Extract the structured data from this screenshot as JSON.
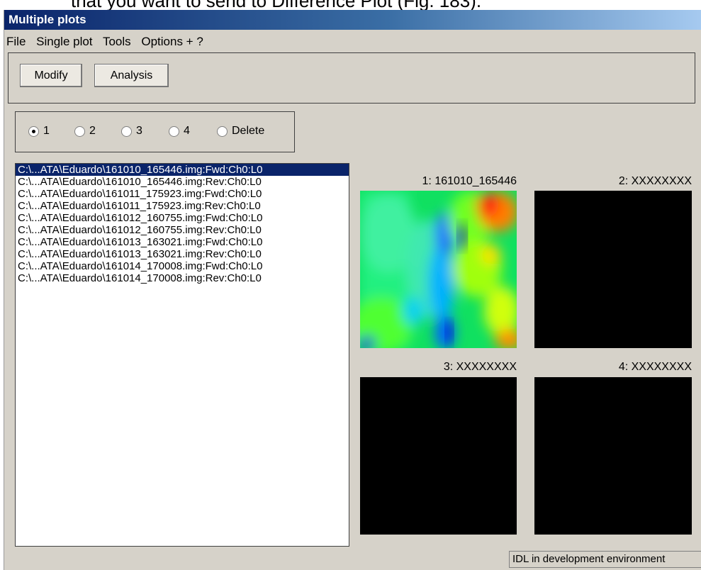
{
  "background_caption": "that you want to send to Difference Plot (Fig. 183).",
  "window": {
    "title": "Multiple plots"
  },
  "menu": [
    "File",
    "Single plot",
    "Tools",
    "Options + ?"
  ],
  "toolbar": {
    "modify_label": "Modify",
    "analysis_label": "Analysis"
  },
  "radio_group": {
    "selected": "1",
    "options": [
      "1",
      "2",
      "3",
      "4",
      "Delete"
    ]
  },
  "file_list": {
    "selected_index": 0,
    "items": [
      "C:\\...ATA\\Eduardo\\161010_165446.img:Fwd:Ch0:L0",
      "C:\\...ATA\\Eduardo\\161010_165446.img:Rev:Ch0:L0",
      "C:\\...ATA\\Eduardo\\161011_175923.img:Fwd:Ch0:L0",
      "C:\\...ATA\\Eduardo\\161011_175923.img:Rev:Ch0:L0",
      "C:\\...ATA\\Eduardo\\161012_160755.img:Fwd:Ch0:L0",
      "C:\\...ATA\\Eduardo\\161012_160755.img:Rev:Ch0:L0",
      "C:\\...ATA\\Eduardo\\161013_163021.img:Fwd:Ch0:L0",
      "C:\\...ATA\\Eduardo\\161013_163021.img:Rev:Ch0:L0",
      "C:\\...ATA\\Eduardo\\161014_170008.img:Fwd:Ch0:L0",
      "C:\\...ATA\\Eduardo\\161014_170008.img:Rev:Ch0:L0"
    ]
  },
  "plots": [
    {
      "label": "1: 161010_165446",
      "content": "heatmap"
    },
    {
      "label": "2: XXXXXXXX",
      "content": "empty"
    },
    {
      "label": "3: XXXXXXXX",
      "content": "empty"
    },
    {
      "label": "4: XXXXXXXX",
      "content": "empty"
    }
  ],
  "status_text": "IDL in development environment",
  "colors": {
    "title_gradient_start": "#0a246a",
    "title_gradient_end": "#a6caf0",
    "window_bg": "#d6d2c9",
    "selection": "#0a246a"
  }
}
